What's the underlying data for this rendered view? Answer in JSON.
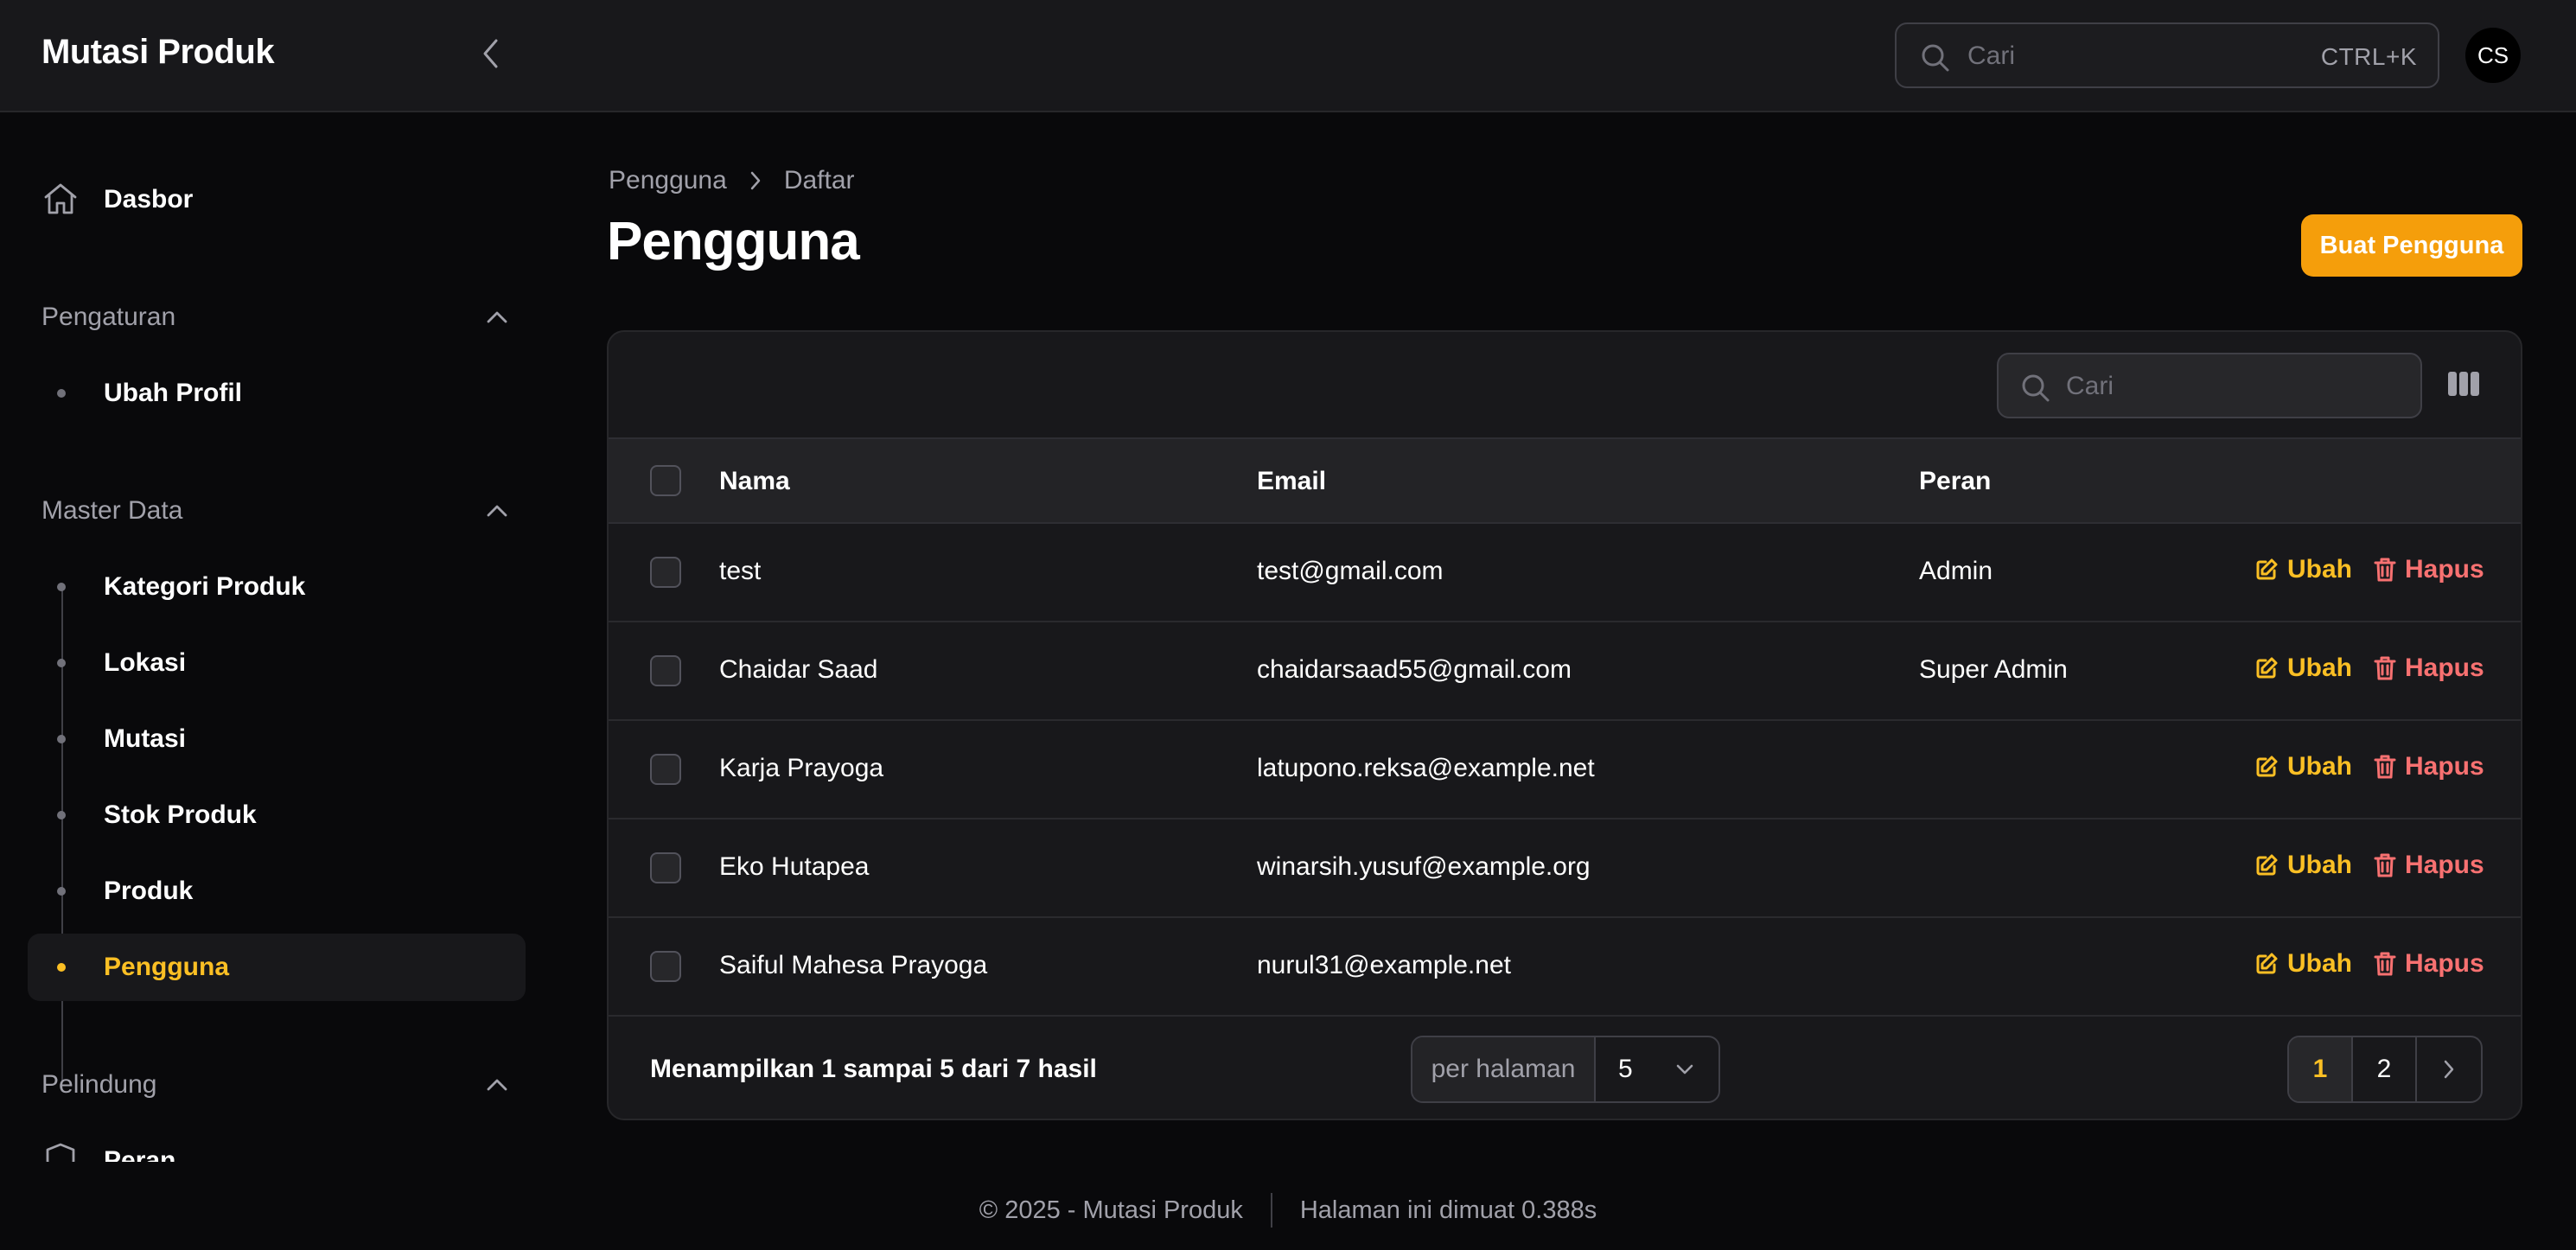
{
  "app": {
    "title": "Mutasi Produk"
  },
  "topbar": {
    "search_placeholder": "Cari",
    "search_shortcut": "CTRL+K",
    "avatar_initials": "CS"
  },
  "sidebar": {
    "dashboard": {
      "label": "Dasbor",
      "icon": "home-icon"
    },
    "groups": [
      {
        "label": "Pengaturan",
        "items": [
          {
            "label": "Ubah Profil"
          }
        ]
      },
      {
        "label": "Master Data",
        "items": [
          {
            "label": "Kategori Produk"
          },
          {
            "label": "Lokasi"
          },
          {
            "label": "Mutasi"
          },
          {
            "label": "Stok Produk"
          },
          {
            "label": "Produk"
          },
          {
            "label": "Pengguna",
            "active": true
          }
        ]
      },
      {
        "label": "Pelindung",
        "items": [
          {
            "label": "Peran",
            "icon": "shield-icon"
          }
        ]
      }
    ]
  },
  "breadcrumb": {
    "items": [
      "Pengguna",
      "Daftar"
    ]
  },
  "page": {
    "title": "Pengguna",
    "create_button": "Buat Pengguna"
  },
  "table": {
    "search_placeholder": "Cari",
    "columns": {
      "name": "Nama",
      "email": "Email",
      "role": "Peran"
    },
    "actions": {
      "edit": "Ubah",
      "delete": "Hapus"
    },
    "rows": [
      {
        "name": "test",
        "email": "test@gmail.com",
        "role": "Admin"
      },
      {
        "name": "Chaidar Saad",
        "email": "chaidarsaad55@gmail.com",
        "role": "Super Admin"
      },
      {
        "name": "Karja Prayoga",
        "email": "latupono.reksa@example.net",
        "role": ""
      },
      {
        "name": "Eko Hutapea",
        "email": "winarsih.yusuf@example.org",
        "role": ""
      },
      {
        "name": "Saiful Mahesa Prayoga",
        "email": "nurul31@example.net",
        "role": ""
      }
    ],
    "summary": "Menampilkan 1 sampai 5 dari 7 hasil",
    "per_page_label": "per halaman",
    "per_page_value": "5",
    "pages": [
      "1",
      "2"
    ],
    "current_page": "1"
  },
  "footer": {
    "copyright": "© 2025 - Mutasi Produk",
    "load_time": "Halaman ini dimuat 0.388s"
  },
  "colors": {
    "accent": "#f59e0b",
    "active": "#fbbf24",
    "danger": "#f87171",
    "background": "#09090b",
    "surface": "#18181b"
  }
}
